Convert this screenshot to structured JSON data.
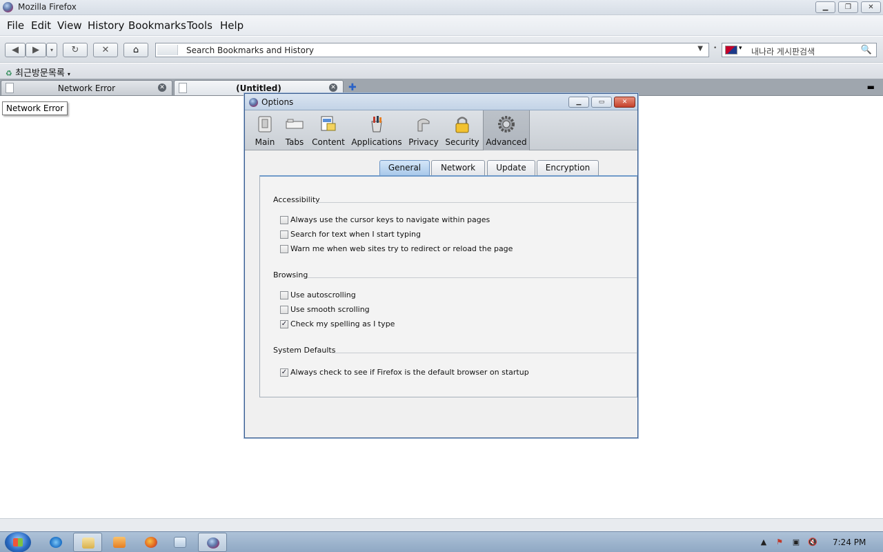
{
  "window": {
    "title": "Mozilla Firefox"
  },
  "menubar": {
    "items": [
      "File",
      "Edit",
      "View",
      "History",
      "Bookmarks",
      "Tools",
      "Help"
    ]
  },
  "navbar": {
    "url_placeholder": "Search Bookmarks and History",
    "search_placeholder": "내나라 게시판검색"
  },
  "bookmarks": {
    "folder_label": "최근방문목록"
  },
  "tabs": [
    {
      "label": "Network Error"
    },
    {
      "label": "(Untitled)"
    }
  ],
  "tooltip": {
    "text": "Network Error"
  },
  "options": {
    "title": "Options",
    "panes": [
      "Main",
      "Tabs",
      "Content",
      "Applications",
      "Privacy",
      "Security",
      "Advanced"
    ],
    "selected_pane": "Advanced",
    "subtabs": [
      "General",
      "Network",
      "Update",
      "Encryption"
    ],
    "active_subtab": "General",
    "groups": [
      {
        "heading": "Accessibility",
        "items": [
          {
            "label": "Always use the cursor keys to navigate within pages",
            "checked": false
          },
          {
            "label": "Search for text when I start typing",
            "checked": false
          },
          {
            "label": "Warn me when web sites try to redirect or reload the page",
            "checked": false
          }
        ]
      },
      {
        "heading": "Browsing",
        "items": [
          {
            "label": "Use autoscrolling",
            "checked": false
          },
          {
            "label": "Use smooth scrolling",
            "checked": false
          },
          {
            "label": "Check my spelling as I type",
            "checked": true
          }
        ]
      },
      {
        "heading": "System Defaults",
        "items": [
          {
            "label": "Always check to see if Firefox is the default browser on startup",
            "checked": true
          }
        ]
      }
    ]
  },
  "taskbar": {
    "clock": "7:24 PM"
  },
  "colors": {
    "accent": "#6f9ac9",
    "taskbar": "#8fa8c4"
  }
}
